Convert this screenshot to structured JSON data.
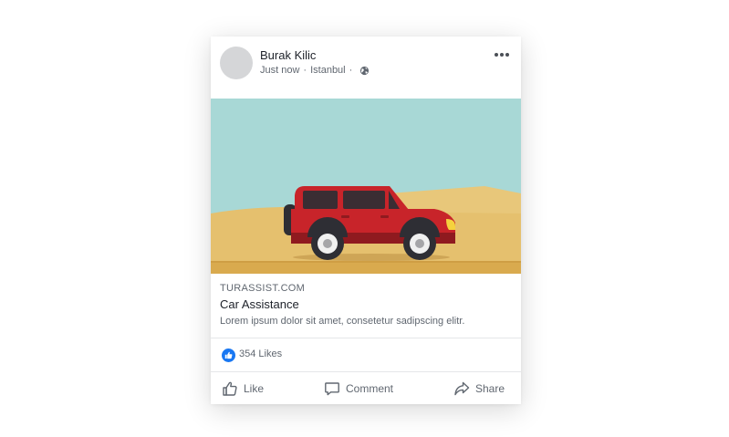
{
  "post": {
    "author": "Burak Kilic",
    "time": "Just now",
    "separator": "·",
    "location": "Istanbul",
    "privacy_icon": "globe-icon",
    "more_icon": "more-options-icon"
  },
  "media": {
    "colors": {
      "sky": "#a8d8d6",
      "sand": "#e5c06e",
      "car_body": "#c8242a",
      "headlight": "#f5d23e"
    }
  },
  "link": {
    "domain": "TURASSIST.COM",
    "title": "Car Assistance",
    "description": "Lorem ipsum dolor sit amet, consetetur sadipscing elitr."
  },
  "reactions": {
    "likes": "354 Likes",
    "icon": "like-badge-icon",
    "accent": "#1877f2"
  },
  "actions": {
    "like": "Like",
    "comment": "Comment",
    "share": "Share"
  }
}
